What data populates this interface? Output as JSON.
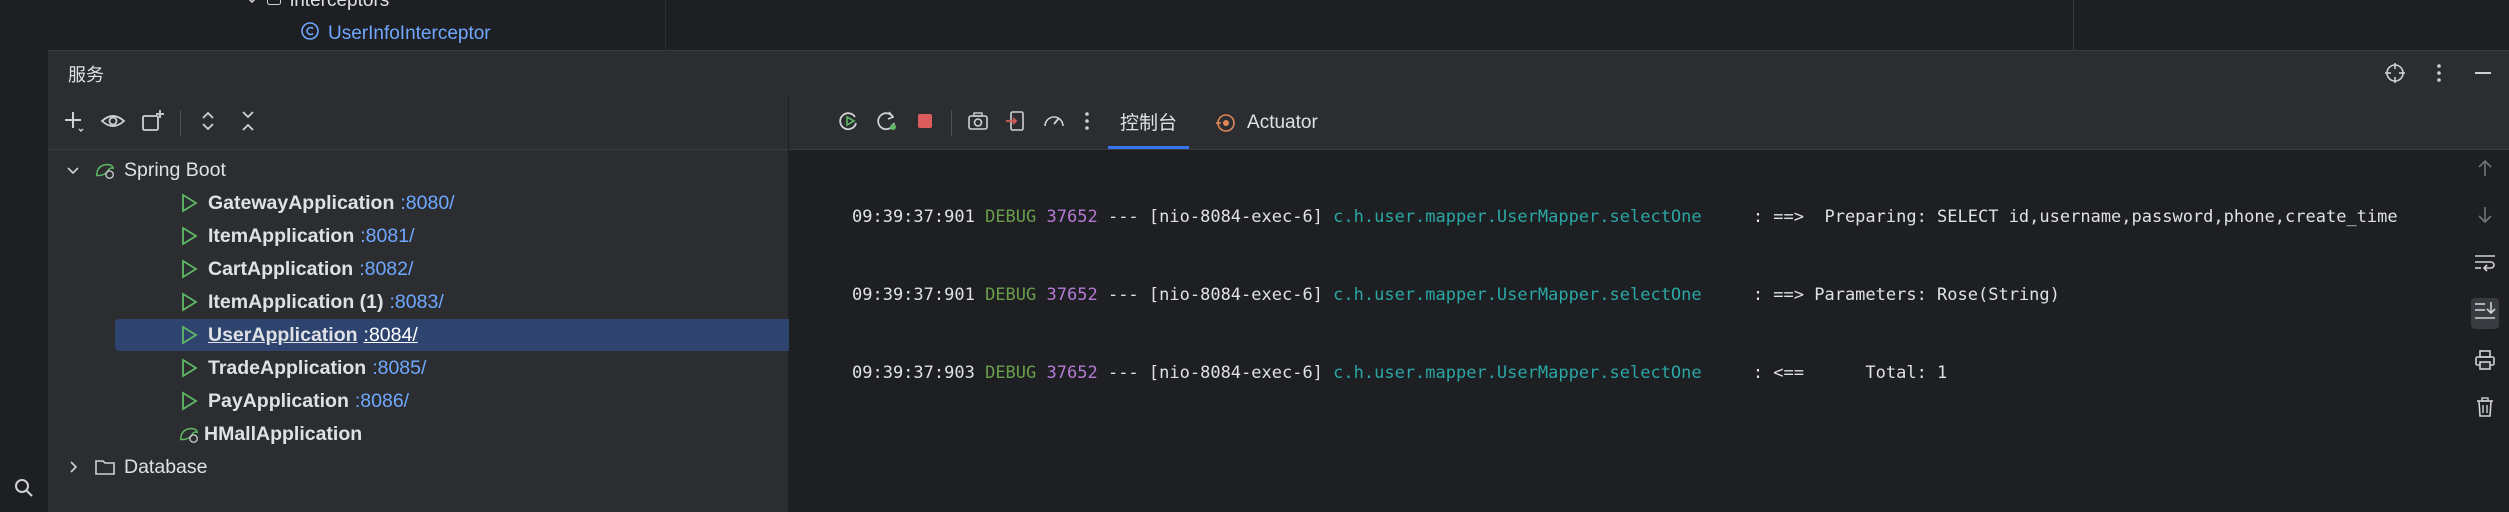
{
  "editor_tree": {
    "interceptors_label": "interceptors",
    "interceptor_class": "UserInfoInterceptor"
  },
  "services": {
    "title": "服务",
    "tree": {
      "root_label": "Spring Boot",
      "apps": [
        {
          "name": "GatewayApplication",
          "port": ":8080/"
        },
        {
          "name": "ItemApplication",
          "port": ":8081/"
        },
        {
          "name": "CartApplication",
          "port": ":8082/"
        },
        {
          "name": "ItemApplication (1)",
          "port": ":8083/"
        },
        {
          "name": "UserApplication",
          "port": ":8084/"
        },
        {
          "name": "TradeApplication",
          "port": ":8085/"
        },
        {
          "name": "PayApplication",
          "port": ":8086/"
        }
      ],
      "hmall_label": "HMallApplication",
      "database_label": "Database"
    },
    "tabs": {
      "console": "控制台",
      "actuator": "Actuator"
    },
    "log_lines": [
      {
        "time": "09:39:37:901",
        "level": "DEBUG",
        "pid": "37652",
        "sep": "---",
        "thread": "[nio-8084-exec-6]",
        "logger": "c.h.user.mapper.UserMapper.selectOne",
        "msg": ": ==>  Preparing: SELECT id,username,password,phone,create_time"
      },
      {
        "time": "09:39:37:901",
        "level": "DEBUG",
        "pid": "37652",
        "sep": "---",
        "thread": "[nio-8084-exec-6]",
        "logger": "c.h.user.mapper.UserMapper.selectOne",
        "msg": ": ==> Parameters: Rose(String)"
      },
      {
        "time": "09:39:37:903",
        "level": "DEBUG",
        "pid": "37652",
        "sep": "---",
        "thread": "[nio-8084-exec-6]",
        "logger": "c.h.user.mapper.UserMapper.selectOne",
        "msg": ": <==      Total: 1"
      }
    ]
  },
  "colors": {
    "accent": "#3574f0",
    "run_green": "#5fb865",
    "port_blue": "#6fa8ff",
    "stop_red": "#db5c5c"
  }
}
